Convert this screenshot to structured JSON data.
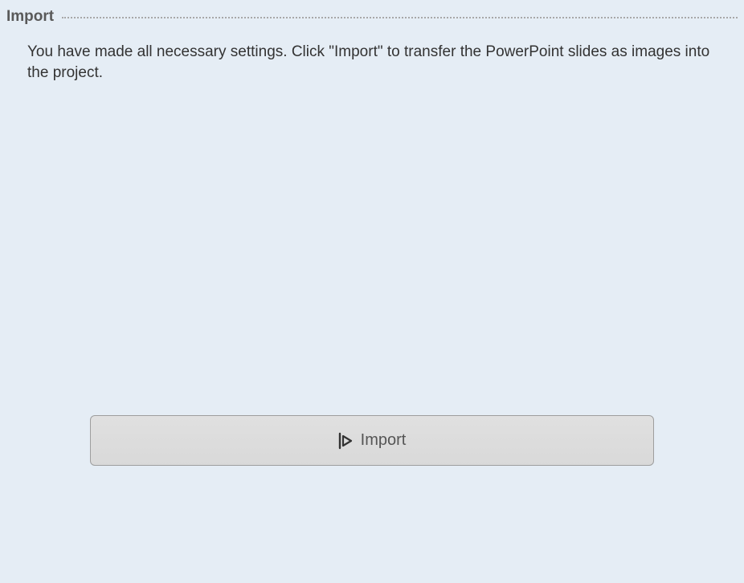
{
  "section": {
    "title": "Import",
    "description": "You have made all necessary settings. Click \"Import\" to transfer the PowerPoint slides as images into the project."
  },
  "actions": {
    "import_label": "Import"
  }
}
